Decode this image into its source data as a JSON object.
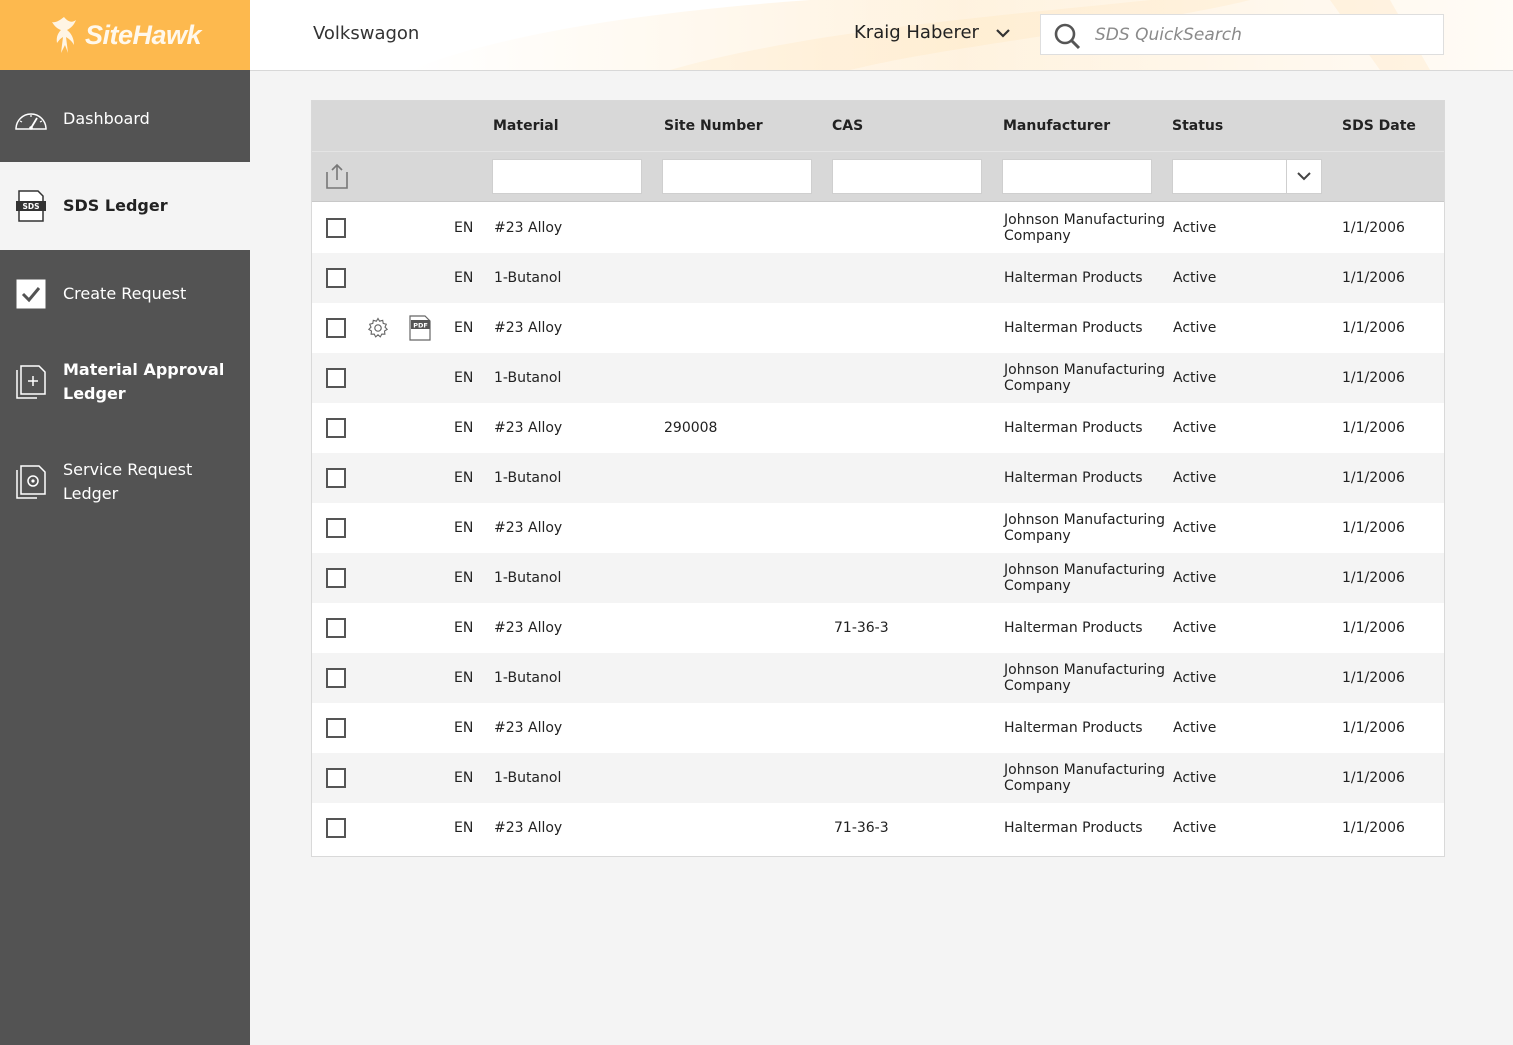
{
  "brand": {
    "logo_text": "SiteHawk",
    "accent": "#fdb94e",
    "sidebar_bg": "#535353"
  },
  "header": {
    "company": "Volkswagon",
    "user_name": "Kraig Haberer",
    "search_placeholder": "SDS QuickSearch"
  },
  "sidebar": {
    "items": [
      {
        "label": "Dashboard",
        "icon": "dashboard-gauge-icon",
        "active": false
      },
      {
        "label": "SDS Ledger",
        "icon": "sds-document-icon",
        "active": true
      },
      {
        "label": "Create Request",
        "icon": "checkbox-check-icon",
        "active": false
      },
      {
        "label": "Material Approval Ledger",
        "icon": "document-plus-icon",
        "active": false
      },
      {
        "label": "Service Request Ledger",
        "icon": "document-gear-icon",
        "active": false
      }
    ]
  },
  "table": {
    "columns": {
      "material": "Material",
      "site_number": "Site Number",
      "cas": "CAS",
      "manufacturer": "Manufacturer",
      "status": "Status",
      "sds_date": "SDS Date"
    },
    "rows": [
      {
        "lang": "EN",
        "material": "#23 Alloy",
        "site_number": "",
        "cas": "",
        "manufacturer": "Johnson Manufacturing Company",
        "status": "Active",
        "sds_date": "1/1/2006"
      },
      {
        "lang": "EN",
        "material": "1-Butanol",
        "site_number": "",
        "cas": "",
        "manufacturer": "Halterman Products",
        "status": "Active",
        "sds_date": "1/1/2006"
      },
      {
        "lang": "EN",
        "material": "#23 Alloy",
        "site_number": "",
        "cas": "",
        "manufacturer": "Halterman Products",
        "status": "Active",
        "sds_date": "1/1/2006",
        "hover_actions": true
      },
      {
        "lang": "EN",
        "material": "1-Butanol",
        "site_number": "",
        "cas": "",
        "manufacturer": "Johnson Manufacturing Company",
        "status": "Active",
        "sds_date": "1/1/2006"
      },
      {
        "lang": "EN",
        "material": "#23 Alloy",
        "site_number": "290008",
        "cas": "",
        "manufacturer": "Halterman Products",
        "status": "Active",
        "sds_date": "1/1/2006"
      },
      {
        "lang": "EN",
        "material": "1-Butanol",
        "site_number": "",
        "cas": "",
        "manufacturer": "Halterman Products",
        "status": "Active",
        "sds_date": "1/1/2006"
      },
      {
        "lang": "EN",
        "material": "#23 Alloy",
        "site_number": "",
        "cas": "",
        "manufacturer": "Johnson Manufacturing Company",
        "status": "Active",
        "sds_date": "1/1/2006"
      },
      {
        "lang": "EN",
        "material": "1-Butanol",
        "site_number": "",
        "cas": "",
        "manufacturer": "Johnson Manufacturing Company",
        "status": "Active",
        "sds_date": "1/1/2006"
      },
      {
        "lang": "EN",
        "material": "#23 Alloy",
        "site_number": "",
        "cas": "71-36-3",
        "manufacturer": "Halterman Products",
        "status": "Active",
        "sds_date": "1/1/2006"
      },
      {
        "lang": "EN",
        "material": "1-Butanol",
        "site_number": "",
        "cas": "",
        "manufacturer": "Johnson Manufacturing Company",
        "status": "Active",
        "sds_date": "1/1/2006"
      },
      {
        "lang": "EN",
        "material": "#23 Alloy",
        "site_number": "",
        "cas": "",
        "manufacturer": "Halterman Products",
        "status": "Active",
        "sds_date": "1/1/2006"
      },
      {
        "lang": "EN",
        "material": "1-Butanol",
        "site_number": "",
        "cas": "",
        "manufacturer": "Johnson Manufacturing Company",
        "status": "Active",
        "sds_date": "1/1/2006"
      },
      {
        "lang": "EN",
        "material": "#23 Alloy",
        "site_number": "",
        "cas": "71-36-3",
        "manufacturer": "Halterman Products",
        "status": "Active",
        "sds_date": "1/1/2006"
      }
    ]
  }
}
